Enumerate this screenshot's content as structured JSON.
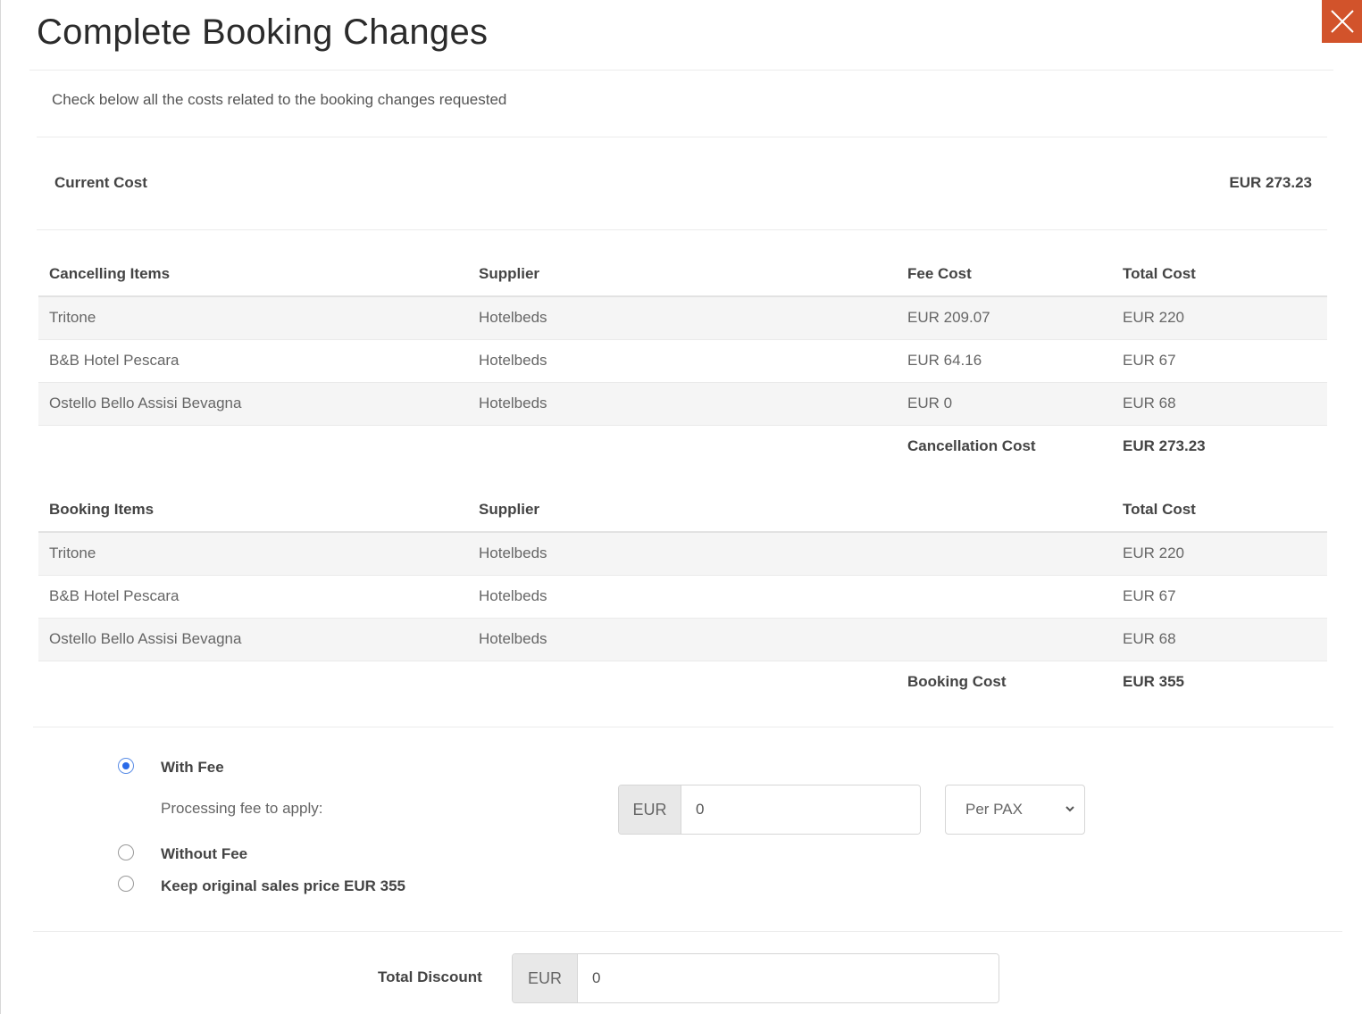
{
  "modal": {
    "title": "Complete Booking Changes",
    "subtitle": "Check below all the costs related to the booking changes requested",
    "close_icon": "close-icon",
    "accent_color": "#d2532b"
  },
  "current_cost": {
    "label": "Current Cost",
    "value": "EUR 273.23"
  },
  "cancelling": {
    "headers": [
      "Cancelling Items",
      "Supplier",
      "Fee Cost",
      "Total Cost"
    ],
    "rows": [
      [
        "Tritone",
        "Hotelbeds",
        "EUR 209.07",
        "EUR 220"
      ],
      [
        "B&B Hotel Pescara",
        "Hotelbeds",
        "EUR 64.16",
        "EUR 67"
      ],
      [
        "Ostello Bello Assisi Bevagna",
        "Hotelbeds",
        "EUR 0",
        "EUR 68"
      ]
    ],
    "total_label": "Cancellation Cost",
    "total_value": "EUR 273.23"
  },
  "booking": {
    "headers": [
      "Booking Items",
      "Supplier",
      "",
      "Total Cost"
    ],
    "rows": [
      [
        "Tritone",
        "Hotelbeds",
        "",
        "EUR 220"
      ],
      [
        "B&B Hotel Pescara",
        "Hotelbeds",
        "",
        "EUR 67"
      ],
      [
        "Ostello Bello Assisi Bevagna",
        "Hotelbeds",
        "",
        "EUR 68"
      ]
    ],
    "total_label": "Booking Cost",
    "total_value": "EUR 355"
  },
  "fee_options": {
    "with_fee": {
      "label": "With Fee",
      "checked": true
    },
    "processing_label": "Processing fee to apply:",
    "fee_currency": "EUR",
    "fee_value": "0",
    "fee_unit": "Per PAX",
    "without_fee": {
      "label": "Without Fee",
      "checked": false
    },
    "keep_original": {
      "label": "Keep original sales price EUR 355",
      "checked": false
    }
  },
  "discount": {
    "label": "Total Discount",
    "currency": "EUR",
    "value": "0"
  }
}
